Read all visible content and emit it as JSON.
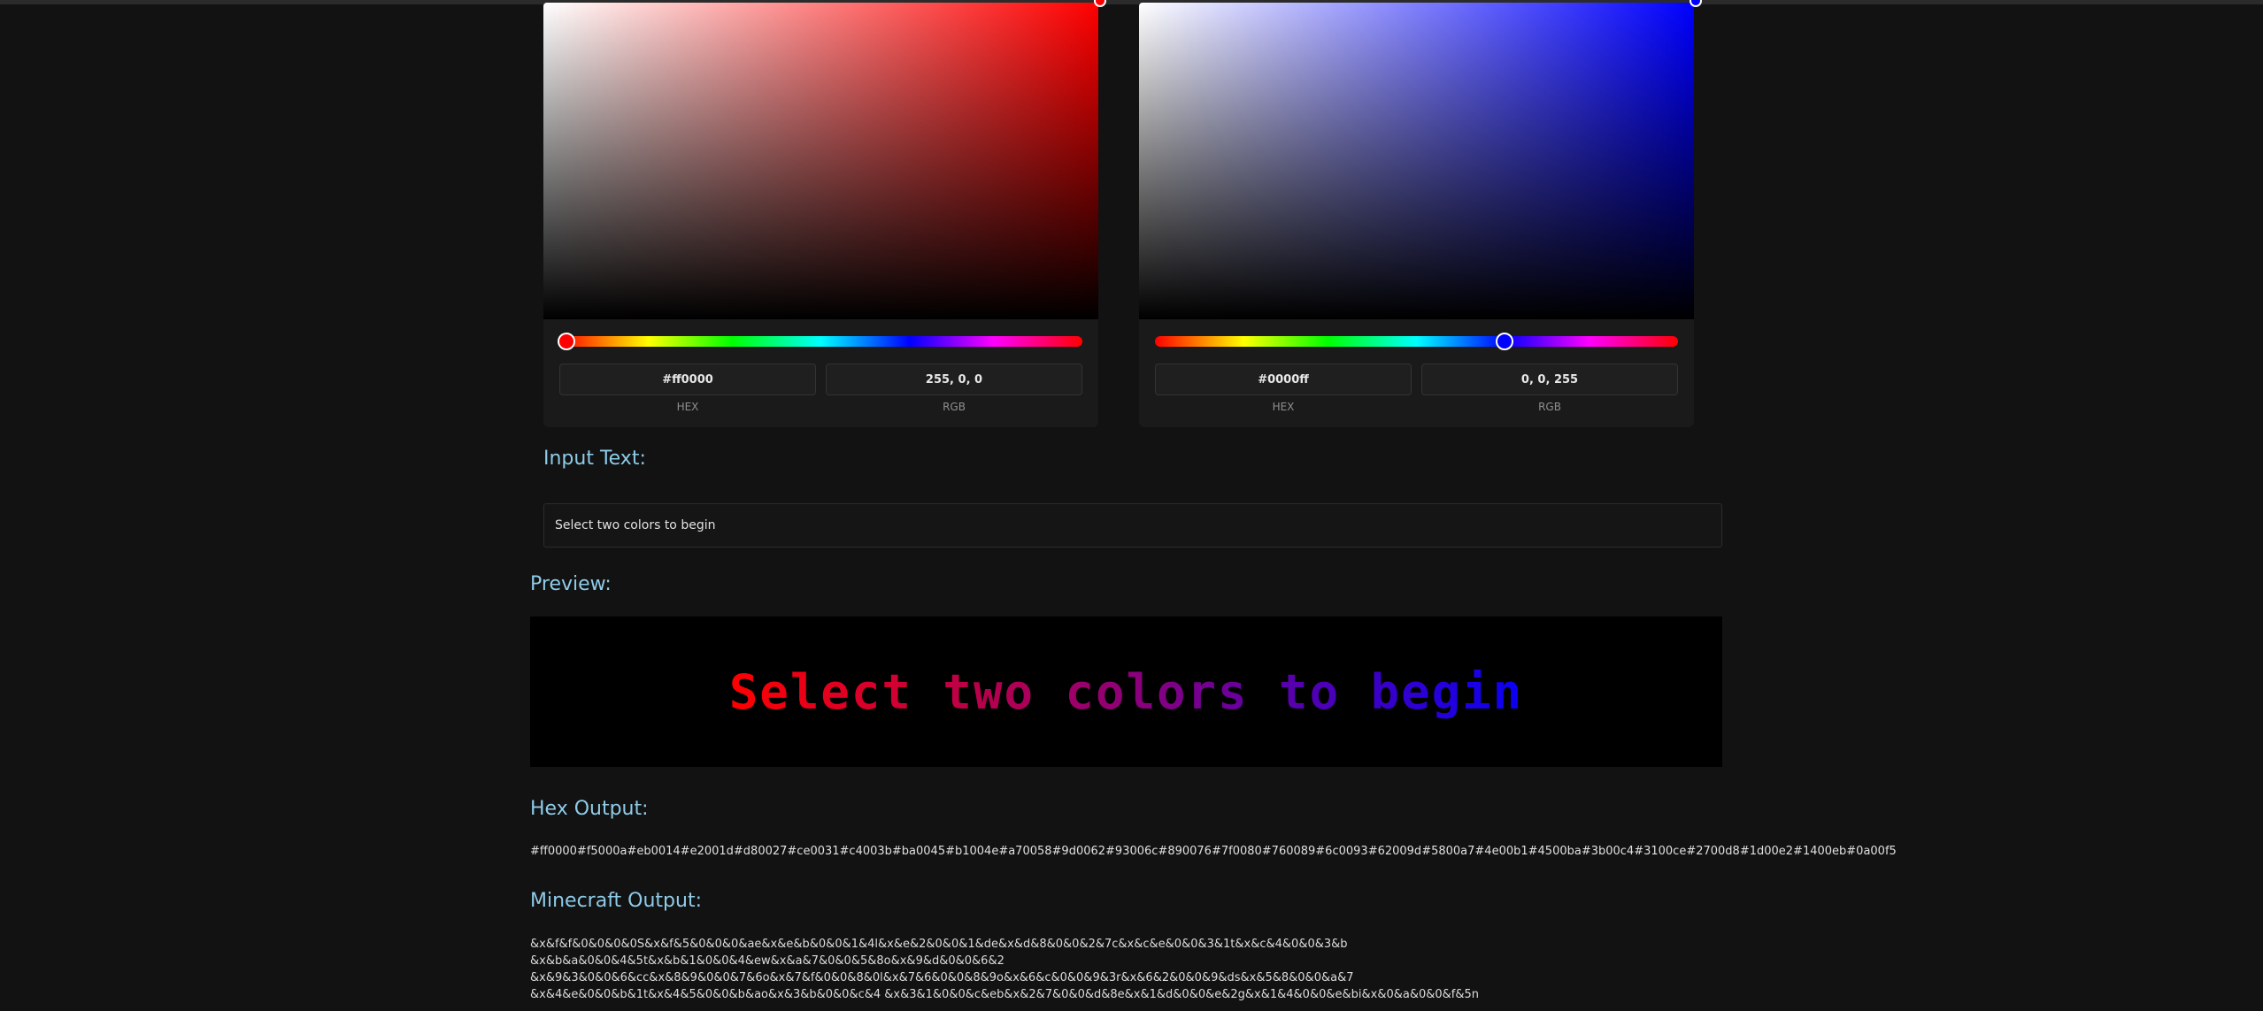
{
  "colors": {
    "background": "#121212",
    "panel": "#1a1a1a",
    "heading": "#8ecbe8",
    "start": "#ff0000",
    "end": "#0000ff"
  },
  "picker_left": {
    "hex_value": "#ff0000",
    "rgb_value": "255, 0, 0",
    "hex_label": "HEX",
    "rgb_label": "RGB",
    "hue_degrees": 0
  },
  "picker_right": {
    "hex_value": "#0000ff",
    "rgb_value": "0, 0, 255",
    "hex_label": "HEX",
    "rgb_label": "RGB",
    "hue_degrees": 240
  },
  "input_section": {
    "heading": "Input Text:",
    "value": "Select two colors to begin"
  },
  "preview_section": {
    "heading": "Preview:",
    "text": "Select two colors to begin"
  },
  "hex_output": {
    "heading": "Hex Output:",
    "value": "#ff0000#f5000a#eb0014#e2001d#d80027#ce0031#c4003b#ba0045#b1004e#a70058#9d0062#93006c#890076#7f0080#760089#6c0093#62009d#5800a7#4e00b1#4500ba#3b00c4#3100ce#2700d8#1d00e2#1400eb#0a00f5"
  },
  "minecraft_output": {
    "heading": "Minecraft Output:",
    "lines": [
      "&x&f&f&0&0&0&0S&x&f&5&0&0&0&ae&x&e&b&0&0&1&4l&x&e&2&0&0&1&de&x&d&8&0&0&2&7c&x&c&e&0&0&3&1t&x&c&4&0&0&3&b",
      "&x&b&a&0&0&4&5t&x&b&1&0&0&4&ew&x&a&7&0&0&5&8o&x&9&d&0&0&6&2",
      "&x&9&3&0&0&6&cc&x&8&9&0&0&7&6o&x&7&f&0&0&8&0l&x&7&6&0&0&8&9o&x&6&c&0&0&9&3r&x&6&2&0&0&9&ds&x&5&8&0&0&a&7",
      "&x&4&e&0&0&b&1t&x&4&5&0&0&b&ao&x&3&b&0&0&c&4 &x&3&1&0&0&c&eb&x&2&7&0&0&d&8e&x&1&d&0&0&e&2g&x&1&4&0&0&e&bi&x&0&a&0&0&f&5n"
    ]
  }
}
